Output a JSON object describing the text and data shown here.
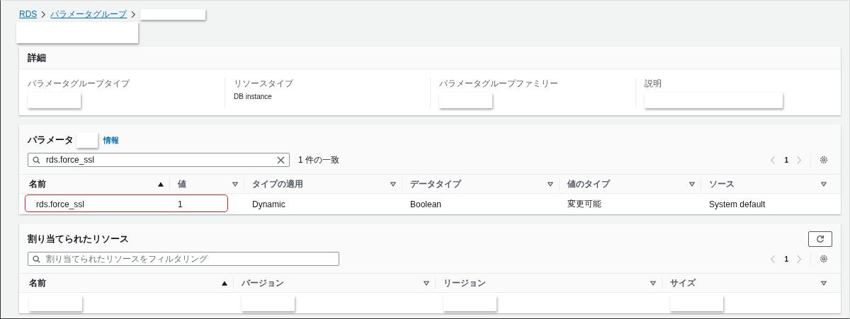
{
  "breadcrumb": [
    {
      "label": "RDS",
      "kind": "link"
    },
    {
      "label": "パラメータグループ",
      "kind": "link"
    }
  ],
  "details": {
    "title": "詳細",
    "fields": [
      {
        "label": "パラメータグループタイプ",
        "redacted": true
      },
      {
        "label": "リソースタイプ",
        "value": "DB instance"
      },
      {
        "label": "パラメータグループファミリー",
        "redacted": true
      },
      {
        "label": "説明",
        "redacted": true
      }
    ]
  },
  "parameters": {
    "title": "パラメータ",
    "info_link": "情報",
    "search": {
      "value": "rds.force_ssl"
    },
    "match_count": "1 件の一致",
    "page": "1",
    "columns": [
      {
        "label": "名前",
        "sorted": true
      },
      {
        "label": "値",
        "sorted": false
      },
      {
        "label": "タイプの適用",
        "sorted": false
      },
      {
        "label": "データタイプ",
        "sorted": false
      },
      {
        "label": "値のタイプ",
        "sorted": false
      },
      {
        "label": "ソース",
        "sorted": false
      }
    ],
    "rows": [
      {
        "highlighted": true,
        "cells": [
          "rds.force_ssl",
          "1",
          "Dynamic",
          "Boolean",
          "変更可能",
          "System default"
        ]
      }
    ]
  },
  "resources": {
    "title": "割り当てられたリソース",
    "search": {
      "placeholder": "割り当てられたリソースをフィルタリング"
    },
    "page": "1",
    "columns": [
      {
        "label": "名前",
        "sorted": true
      },
      {
        "label": "バージョン",
        "sorted": false
      },
      {
        "label": "リージョン",
        "sorted": false
      },
      {
        "label": "サイズ",
        "sorted": false
      }
    ]
  }
}
